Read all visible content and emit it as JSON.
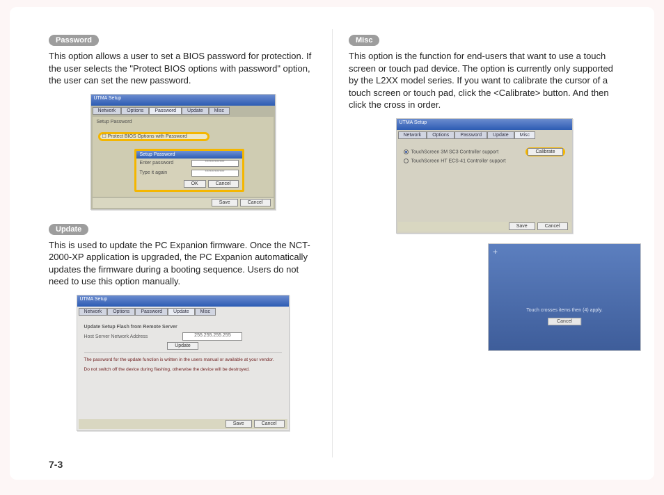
{
  "page_number": "7-3",
  "left": {
    "password": {
      "heading": "Password",
      "text": "This option allows a user to set a BIOS password for protection. If the user selects the \"Protect BIOS options with password\" option, the user can set the new password.",
      "window_title": "UTMA Setup",
      "tabs": [
        "Network",
        "Options",
        "Password",
        "Update",
        "Misc"
      ],
      "active_tab": 2,
      "setup_label": "Setup Password",
      "protect_option": "Protect BIOS Options with Password",
      "dialog_title": "Setup Password",
      "enter_label": "Enter password",
      "again_label": "Type it again",
      "masked": "************",
      "ok": "OK",
      "cancel": "Cancel",
      "save": "Save"
    },
    "update": {
      "heading": "Update",
      "text": "This is used to update the PC Expanion firmware. Once the NCT-2000-XP application is upgraded, the PC Expanion automatically updates the firmware during a booting sequence. Users do not need to use this option manually.",
      "window_title": "UTMA Setup",
      "tabs": [
        "Network",
        "Options",
        "Password",
        "Update",
        "Misc"
      ],
      "active_tab": 3,
      "flash_heading": "Update Setup Flash from Remote Server",
      "addr_label": "Host Server Network Address",
      "addr_value": "255.255.255.255",
      "update_btn": "Update",
      "note1": "The password for the update function is written in the users manual or available at your vendor.",
      "note2": "Do not switch off the device during flashing, otherwise the device will be destroyed.",
      "save": "Save",
      "cancel": "Cancel"
    }
  },
  "right": {
    "misc": {
      "heading": "Misc",
      "text": "This option is the function for end-users that want to use a touch screen or touch pad device. The option is currently only supported by the L2XX model series. If you want to calibrate the cursor of a touch screen or touch pad, click the <Calibrate> button. And then click the cross in order.",
      "window_title": "UTMA Setup",
      "tabs": [
        "Network",
        "Options",
        "Password",
        "Update",
        "Misc"
      ],
      "active_tab": 4,
      "opt1": "TouchScreen 3M SC3 Controller support",
      "opt2": "TouchScreen HT ECS-41 Controller support",
      "calibrate_btn": "Calibrate",
      "save": "Save",
      "cancel": "Cancel"
    },
    "blue": {
      "hint": "Touch crosses items then (4) apply.",
      "cancel": "Cancel"
    }
  }
}
